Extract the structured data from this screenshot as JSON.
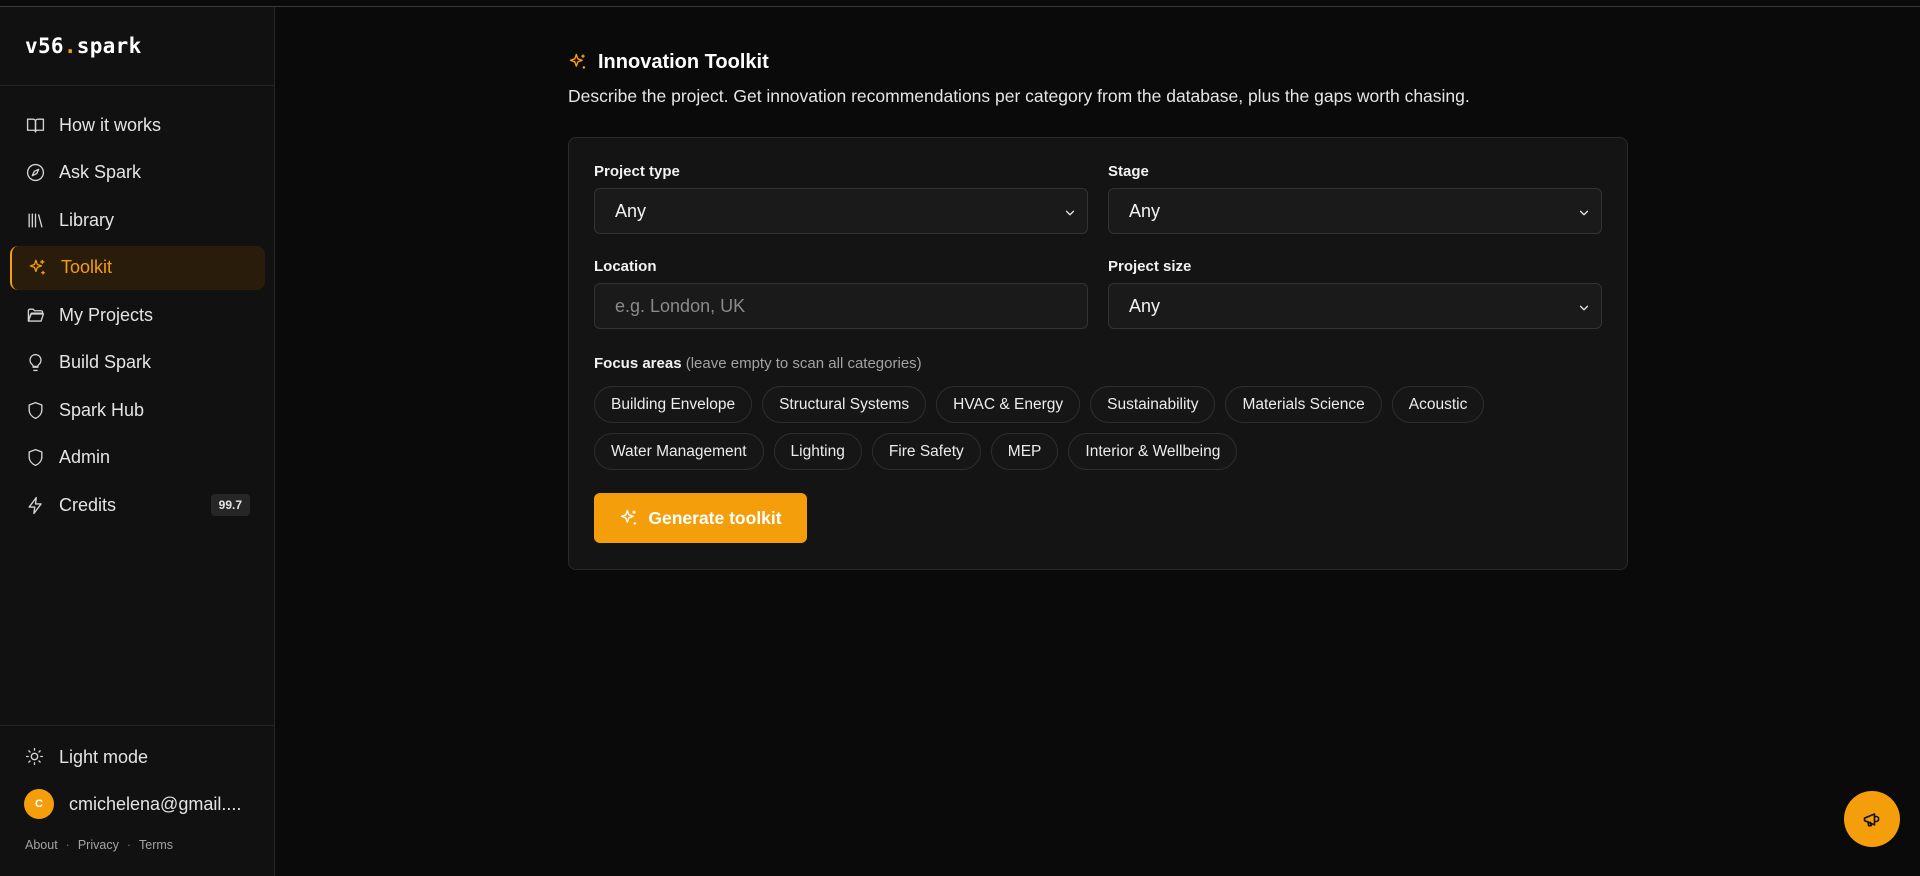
{
  "brand": {
    "prefix": "v56",
    "dot": ".",
    "suffix": "spark"
  },
  "sidebar": {
    "items": [
      {
        "label": "How it works",
        "icon": "book-icon"
      },
      {
        "label": "Ask Spark",
        "icon": "compass-icon"
      },
      {
        "label": "Library",
        "icon": "library-icon"
      },
      {
        "label": "Toolkit",
        "icon": "sparkles-icon",
        "active": true
      },
      {
        "label": "My Projects",
        "icon": "folder-icon"
      },
      {
        "label": "Build Spark",
        "icon": "lightbulb-icon"
      },
      {
        "label": "Spark Hub",
        "icon": "shield-icon"
      },
      {
        "label": "Admin",
        "icon": "shield-icon"
      },
      {
        "label": "Credits",
        "icon": "zap-icon",
        "badge": "99.7"
      }
    ],
    "theme_toggle": "Light mode",
    "user": {
      "initial": "C",
      "email": "cmichelena@gmail...."
    },
    "footer": {
      "about": "About",
      "privacy": "Privacy",
      "terms": "Terms",
      "separator": "·"
    }
  },
  "main": {
    "title": "Innovation Toolkit",
    "subtitle": "Describe the project. Get innovation recommendations per category from the database, plus the gaps worth chasing.",
    "form": {
      "project_type": {
        "label": "Project type",
        "value": "Any"
      },
      "stage": {
        "label": "Stage",
        "value": "Any"
      },
      "location": {
        "label": "Location",
        "placeholder": "e.g. London, UK",
        "value": ""
      },
      "project_size": {
        "label": "Project size",
        "value": "Any"
      },
      "focus": {
        "label": "Focus areas",
        "hint": "(leave empty to scan all categories)",
        "chips_row1": [
          "Building Envelope",
          "Structural Systems",
          "HVAC & Energy",
          "Sustainability",
          "Materials Science",
          "Acoustic"
        ],
        "chips_row2": [
          "Water Management",
          "Lighting",
          "Fire Safety",
          "MEP",
          "Interior & Wellbeing"
        ]
      },
      "generate_label": "Generate toolkit"
    }
  },
  "colors": {
    "accent": "#f59e0b",
    "background": "#0a0a0a",
    "sidebar": "#111111",
    "card": "#141414"
  }
}
